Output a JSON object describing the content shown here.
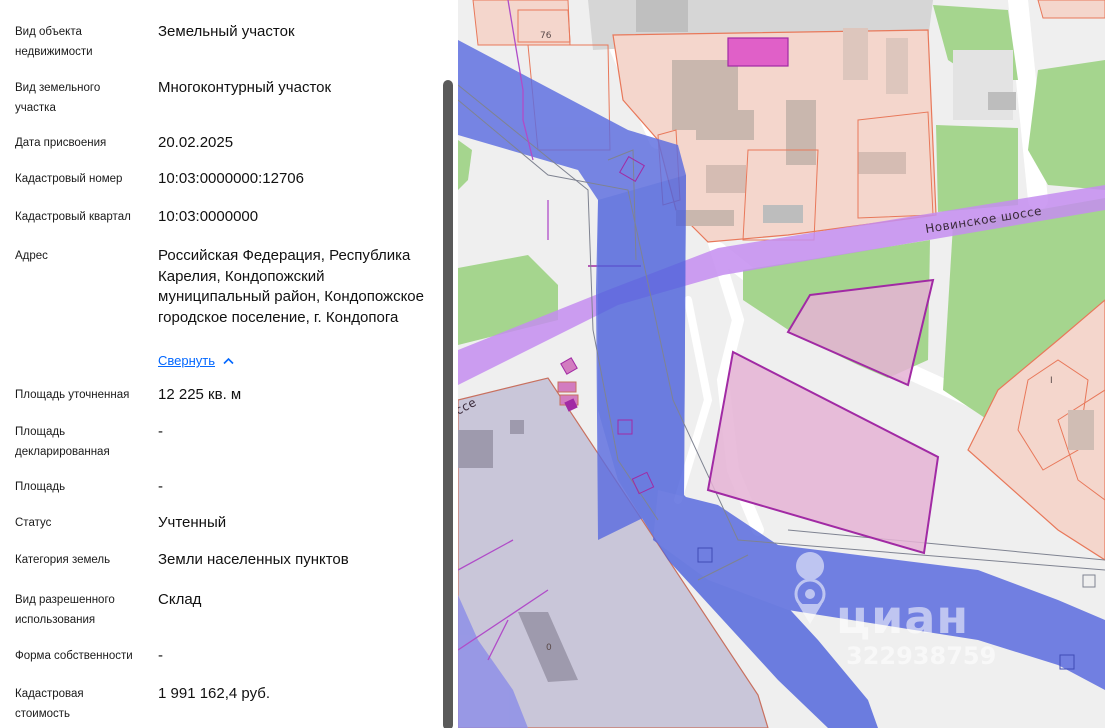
{
  "details": {
    "rows": [
      {
        "label": "Вид объекта недвижимости",
        "value": "Земельный участок"
      },
      {
        "label": "Вид земельного участка",
        "value": "Многоконтурный участок"
      },
      {
        "label": "Дата присвоения",
        "value": "20.02.2025"
      },
      {
        "label": "Кадастровый номер",
        "value": "10:03:0000000:12706"
      },
      {
        "label": "Кадастровый квартал",
        "value": "10:03:0000000"
      },
      {
        "label": "Адрес",
        "value": "Российская Федерация, Республика Карелия, Кондопожский муниципальный район, Кондопожское городское поселение, г. Кондопога"
      },
      {
        "label": "Площадь уточненная",
        "value": "12 225 кв. м"
      },
      {
        "label": "Площадь декларированная",
        "value": "-"
      },
      {
        "label": "Площадь",
        "value": "-"
      },
      {
        "label": "Статус",
        "value": "Учтенный"
      },
      {
        "label": "Категория земель",
        "value": "Земли населенных пунктов"
      },
      {
        "label": "Вид разрешенного использования",
        "value": "Склад"
      },
      {
        "label": "Форма собственности",
        "value": "-"
      },
      {
        "label": "Кадастровая стоимость",
        "value": "1 991 162,4 руб."
      }
    ],
    "collapse_label": "Свернуть",
    "collapse_icon": "chevron-up-icon"
  },
  "map": {
    "road_label": "Новинское шоссе",
    "road_label_partial": "ссе",
    "parcel_number_top": "76",
    "parcel_number_right": "I",
    "parcel_number_bottom": "0",
    "watermark_brand": "циан",
    "watermark_id": "322938759",
    "watermark_icon": "map-pin-icon",
    "colors": {
      "background": "#efefef",
      "green_zone": "#a5d58e",
      "blue_zone": "#5c6de0",
      "road_purple": "#c48df0",
      "parcel_pink": "#e5b3d5",
      "parcel_border": "#a12aa4",
      "building_zone": "#f4d6cc",
      "building_border": "#e8785a"
    }
  }
}
